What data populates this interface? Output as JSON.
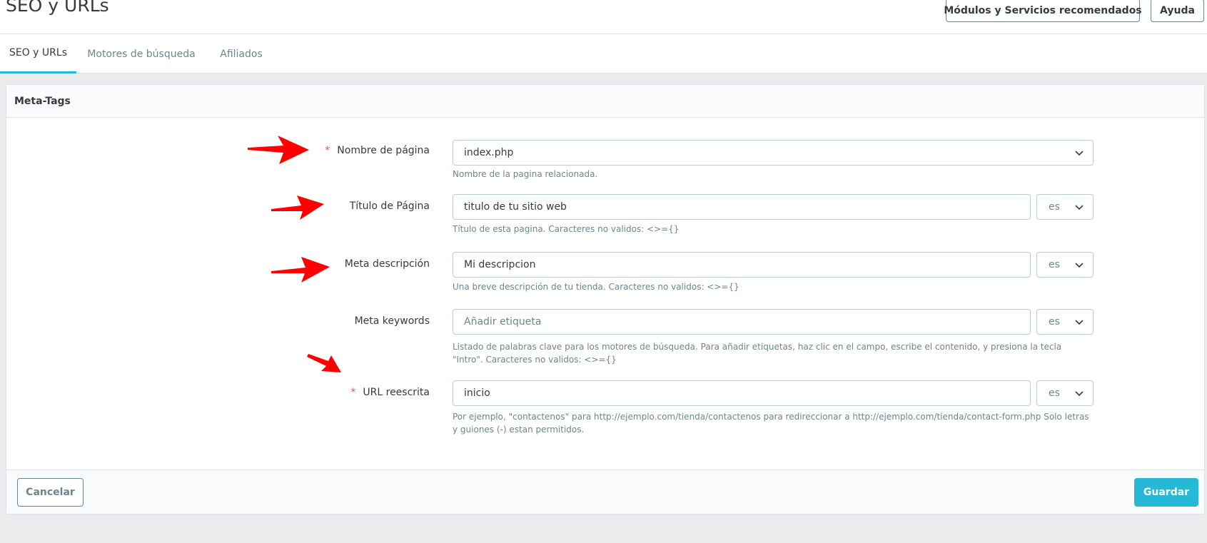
{
  "header": {
    "title": "SEO y URLs",
    "recommended_label": "Módulos y Servicios recomendados",
    "help_label": "Ayuda"
  },
  "tabs": [
    {
      "label": "SEO y URLs",
      "active": true
    },
    {
      "label": "Motores de búsqueda",
      "active": false
    },
    {
      "label": "Afiliados",
      "active": false
    }
  ],
  "panel": {
    "title": "Meta-Tags",
    "fields": {
      "page_name": {
        "label": "Nombre de página",
        "required": true,
        "value": "index.php",
        "help": "Nombre de la pagina relacionada."
      },
      "page_title": {
        "label": "Título de Página",
        "value": "titulo de tu sitio web",
        "lang": "es",
        "help": "Título de esta pagina. Caracteres no validos: <>={}"
      },
      "meta_description": {
        "label": "Meta descripción",
        "value": "Mi descripcion",
        "lang": "es",
        "help": "Una breve descripción de tu tienda. Caracteres no validos: <>={}"
      },
      "meta_keywords": {
        "label": "Meta keywords",
        "placeholder": "Añadir etiqueta",
        "lang": "es",
        "help": "Listado de palabras clave para los motores de búsqueda. Para añadir etiquetas, haz clic en el campo, escribe el contenido, y presiona la tecla \"Intro\". Caracteres no validos: <>={}"
      },
      "rewritten_url": {
        "label": "URL reescrita",
        "required": true,
        "value": "inicio",
        "lang": "es",
        "help": "Por ejemplo, \"contactenos\" para http://ejemplo.com/tienda/contactenos para redireccionar a http://ejemplo.com/tienda/contact-form.php Solo letras y guiones (-) estan permitidos."
      }
    },
    "required_mark": "*"
  },
  "footer": {
    "cancel_label": "Cancelar",
    "save_label": "Guardar"
  },
  "colors": {
    "accent": "#25b9d7",
    "annotation_arrow": "#ff0000",
    "required": "#c05c67"
  },
  "icons": {
    "dropdown": "chevron-down-icon",
    "annotation": "red-arrow-icon"
  }
}
